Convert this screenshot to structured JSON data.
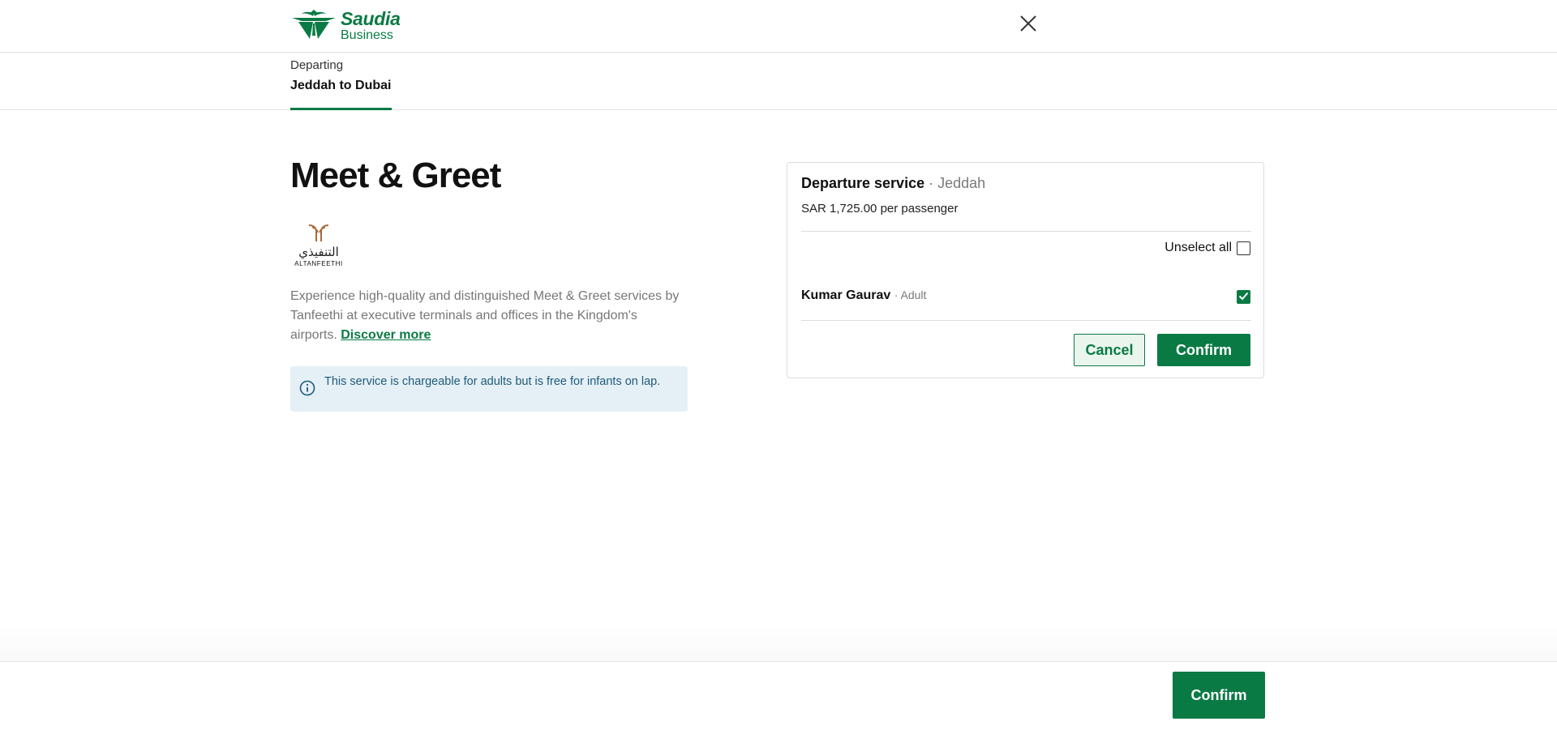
{
  "header": {
    "logo_line1": "Saudia",
    "logo_line2": "Business",
    "close_icon": "close-icon"
  },
  "tab": {
    "sub_label": "Departing",
    "route": "Jeddah to Dubai"
  },
  "main": {
    "title": "Meet & Greet",
    "brand_arabic": "التنفيذي",
    "brand_english": "ALTANFEETHI",
    "description": "Experience high-quality and distinguished Meet & Greet services by Tanfeethi at executive terminals and offices in the Kingdom's airports.",
    "discover_link": "Discover more",
    "info_text": "This service is chargeable for adults but is free for infants on lap."
  },
  "panel": {
    "service_title": "Departure service",
    "service_location": "· Jeddah",
    "price_text": "SAR 1,725.00 per passenger",
    "unselect_all_label": "Unselect all",
    "unselect_all_checked": false,
    "passenger": {
      "name": "Kumar Gaurav",
      "type": "· Adult",
      "checked": true
    },
    "cancel_label": "Cancel",
    "confirm_label": "Confirm"
  },
  "footer": {
    "confirm_label": "Confirm"
  },
  "colors": {
    "brand_green": "#0a7a44",
    "info_bg": "#e5f0f6",
    "info_text": "#1f5a7a"
  }
}
